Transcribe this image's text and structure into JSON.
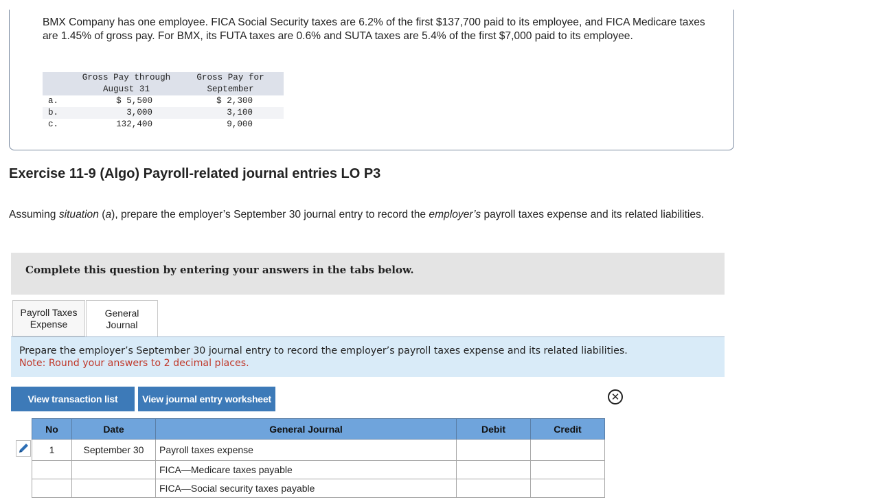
{
  "problem": {
    "text": "BMX Company has one employee. FICA Social Security taxes are 6.2% of the first $137,700 paid to its employee, and FICA Medicare taxes are 1.45% of gross pay. For BMX, its FUTA taxes are 0.6% and SUTA taxes are 5.4% of the first $7,000 paid to its employee.",
    "table": {
      "header_a_line1": "Gross Pay through",
      "header_a_line2": "August 31",
      "header_b_line1": "Gross Pay for",
      "header_b_line2": "September",
      "rows": [
        {
          "label": "a.",
          "a": "$ 5,500",
          "b": "$ 2,300"
        },
        {
          "label": "b.",
          "a": "3,000",
          "b": "3,100"
        },
        {
          "label": "c.",
          "a": "132,400",
          "b": "9,000"
        }
      ]
    }
  },
  "exercise_title": "Exercise 11-9 (Algo) Payroll-related journal entries LO P3",
  "instructions": {
    "p1": "Assuming ",
    "situation": "situation",
    "p2": " (",
    "a": "a",
    "p3": "), prepare the employer’s September 30 journal entry to record the ",
    "employers": "employer’s",
    "p4": " payroll taxes expense and its related liabilities."
  },
  "banner": "Complete this question by entering your answers in the tabs below.",
  "tabs": [
    {
      "line1": "Payroll Taxes",
      "line2": "Expense"
    },
    {
      "line1": "General",
      "line2": "Journal"
    }
  ],
  "prompt": {
    "line1": "Prepare the employer’s September 30 journal entry to record the employer’s payroll taxes expense and its related liabilities.",
    "note": "Note: Round your answers to 2 decimal places."
  },
  "buttons": {
    "transaction_list": "View transaction list",
    "journal_worksheet": "View journal entry worksheet"
  },
  "icons": {
    "close": "close-circle-icon",
    "edit": "pencil-icon"
  },
  "journal": {
    "headers": {
      "no": "No",
      "date": "Date",
      "general": "General Journal",
      "debit": "Debit",
      "credit": "Credit"
    },
    "rows": [
      {
        "no": "1",
        "date": "September 30",
        "account": "Payroll taxes expense",
        "debit": "",
        "credit": ""
      },
      {
        "no": "",
        "date": "",
        "account": "FICA—Medicare taxes payable",
        "debit": "",
        "credit": ""
      },
      {
        "no": "",
        "date": "",
        "account": "FICA—Social security taxes payable",
        "debit": "",
        "credit": ""
      }
    ]
  },
  "colors": {
    "header_blue": "#6fa4dc",
    "button_blue": "#3d7ab8",
    "note_red": "#c0392b",
    "panel_blue": "#d9ebf8"
  }
}
